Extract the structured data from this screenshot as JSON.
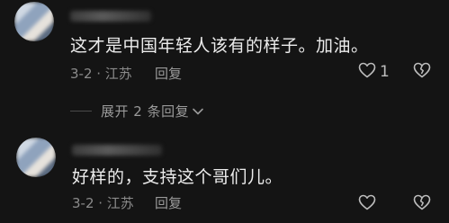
{
  "comments": [
    {
      "text": "这才是中国年轻人该有的样子。加油。",
      "date_location": "3-2 · 江苏",
      "reply_label": "回复",
      "like_count": "1"
    },
    {
      "text": "好样的，支持这个哥们儿。",
      "date_location": "3-2 · 江苏",
      "reply_label": "回复",
      "like_count": ""
    }
  ],
  "expand_replies_label": "展开 2 条回复",
  "icons": {
    "like": "heart-outline-icon",
    "dislike": "broken-heart-icon",
    "expand": "chevron-down-icon"
  },
  "colors": {
    "background": "#141414",
    "text_primary": "#ececec",
    "text_secondary": "#8b8b8b"
  }
}
